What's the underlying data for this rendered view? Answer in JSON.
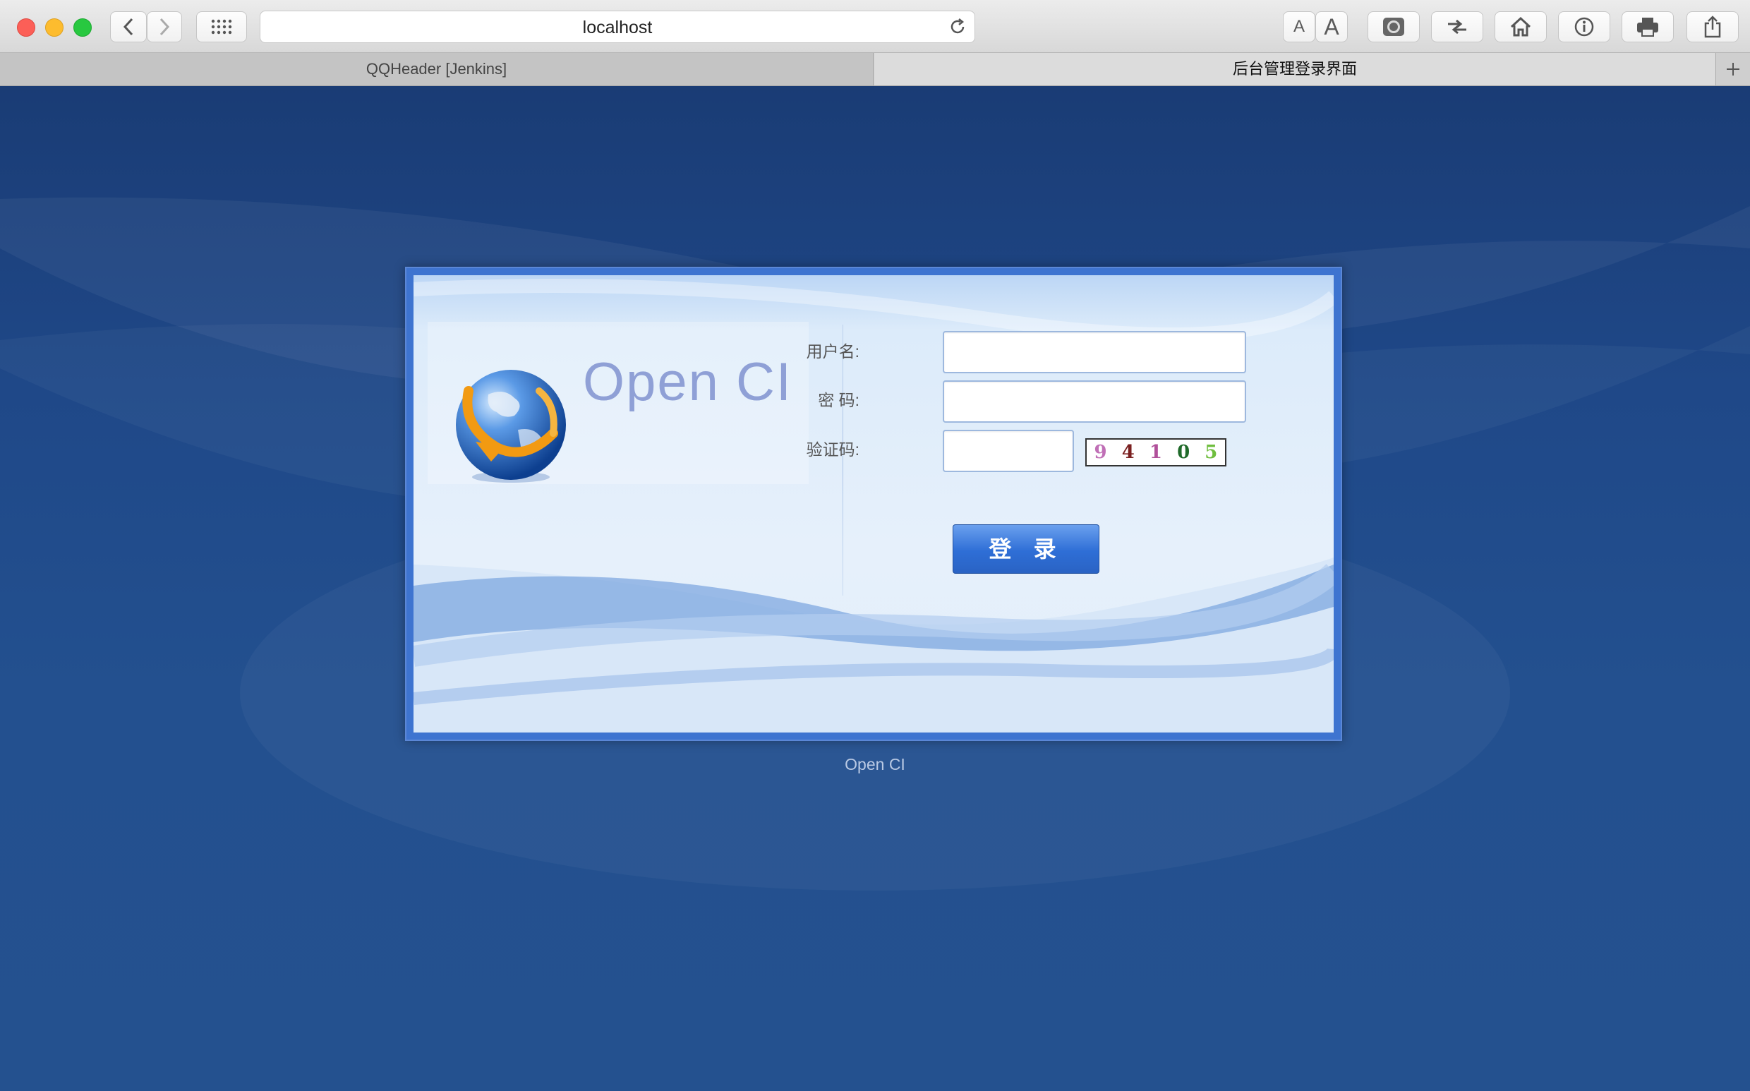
{
  "browser": {
    "url": "localhost",
    "tabs": [
      {
        "label": "QQHeader [Jenkins]"
      },
      {
        "label": "后台管理登录界面"
      }
    ],
    "toolbar_buttons": [
      "back-icon",
      "forward-icon",
      "grid-icon",
      "text-smaller-icon",
      "text-larger-icon",
      "reader-icon",
      "translate-icon",
      "home-icon",
      "info-icon",
      "print-icon",
      "share-icon"
    ]
  },
  "login": {
    "logo_text": "Open CI",
    "username_label": "用户名:",
    "password_label": "密 码:",
    "captcha_label": "验证码:",
    "username_value": "",
    "password_value": "",
    "captcha_value": "",
    "captcha_chars": [
      "9",
      "4",
      "1",
      "0",
      "5"
    ],
    "captcha_colors": [
      "#c06fb6",
      "#7a2020",
      "#b0509a",
      "#1f6a2a",
      "#6fbe3e"
    ],
    "submit_label": "登 录"
  },
  "footer": {
    "text": "Open CI"
  },
  "colors": {
    "background": "#1e4a8c",
    "panel_border": "#3e74d0",
    "button": "#2e6ed6"
  }
}
